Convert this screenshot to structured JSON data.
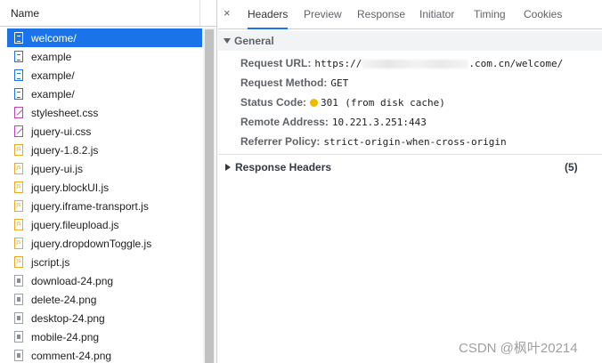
{
  "network": {
    "name_header": "Name",
    "requests": [
      {
        "name": "welcome/",
        "type": "doc",
        "icon": "document-icon",
        "selected": true
      },
      {
        "name": "example",
        "type": "doc",
        "icon": "document-icon"
      },
      {
        "name": "example/",
        "type": "doc",
        "icon": "document-icon"
      },
      {
        "name": "example/",
        "type": "doc",
        "icon": "document-icon"
      },
      {
        "name": "stylesheet.css",
        "type": "css",
        "icon": "stylesheet-icon"
      },
      {
        "name": "jquery-ui.css",
        "type": "css",
        "icon": "stylesheet-icon"
      },
      {
        "name": "jquery-1.8.2.js",
        "type": "js",
        "icon": "script-icon"
      },
      {
        "name": "jquery-ui.js",
        "type": "js",
        "icon": "script-icon"
      },
      {
        "name": "jquery.blockUI.js",
        "type": "js",
        "icon": "script-icon"
      },
      {
        "name": "jquery.iframe-transport.js",
        "type": "js",
        "icon": "script-icon"
      },
      {
        "name": "jquery.fileupload.js",
        "type": "js",
        "icon": "script-icon"
      },
      {
        "name": "jquery.dropdownToggle.js",
        "type": "js",
        "icon": "script-icon"
      },
      {
        "name": "jscript.js",
        "type": "js",
        "icon": "script-icon"
      },
      {
        "name": "download-24.png",
        "type": "img",
        "icon": "image-icon"
      },
      {
        "name": "delete-24.png",
        "type": "img",
        "icon": "image-icon"
      },
      {
        "name": "desktop-24.png",
        "type": "img",
        "icon": "image-icon"
      },
      {
        "name": "mobile-24.png",
        "type": "img",
        "icon": "image-icon"
      },
      {
        "name": "comment-24.png",
        "type": "img",
        "icon": "image-icon"
      }
    ]
  },
  "details": {
    "close_icon": "×",
    "tabs": [
      "Headers",
      "Preview",
      "Response",
      "Initiator",
      "Timing",
      "Cookies"
    ],
    "active_tab": "Headers",
    "general": {
      "title": "General",
      "request_url_label": "Request URL:",
      "request_url_prefix": "https://",
      "request_url_suffix": ".com.cn/welcome/",
      "request_method_label": "Request Method:",
      "request_method": "GET",
      "status_code_label": "Status Code:",
      "status_code": "301",
      "status_note": "(from disk cache)",
      "status_color": "#f0b900",
      "remote_address_label": "Remote Address:",
      "remote_address": "10.221.3.251:443",
      "referrer_policy_label": "Referrer Policy:",
      "referrer_policy": "strict-origin-when-cross-origin"
    },
    "response_headers": {
      "title": "Response Headers",
      "count": "(5)"
    }
  },
  "watermark": "CSDN @枫叶20214",
  "colors": {
    "selection": "#1a73e8",
    "active_tab_underline": "#1a73e8"
  }
}
